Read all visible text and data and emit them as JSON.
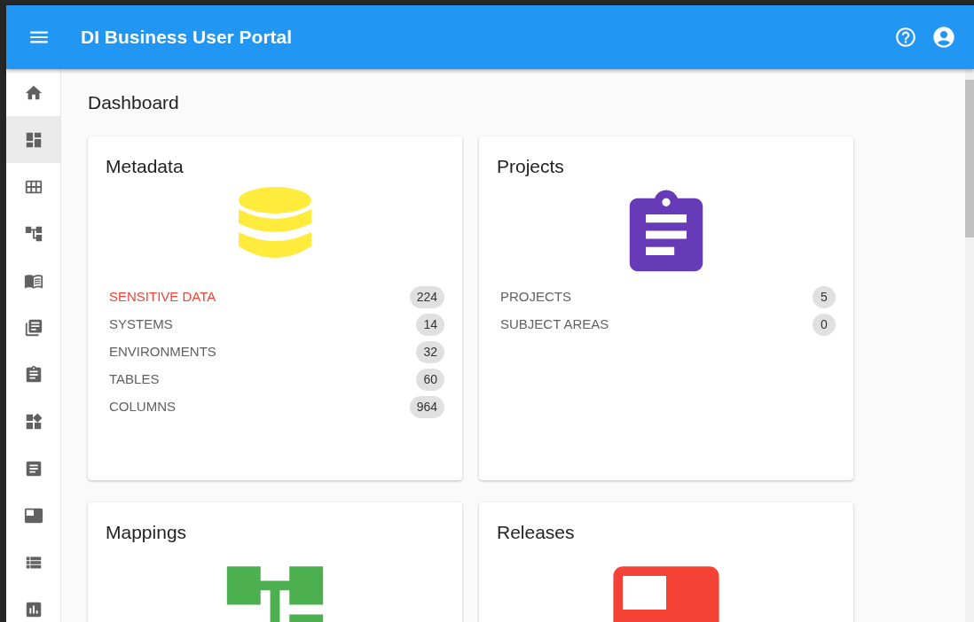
{
  "header": {
    "title": "DI Business User Portal"
  },
  "sidebar": {
    "items": [
      {
        "kind": "home",
        "selected": false
      },
      {
        "kind": "dashboard",
        "selected": true
      },
      {
        "kind": "table",
        "selected": false
      },
      {
        "kind": "tree",
        "selected": false
      },
      {
        "kind": "book",
        "selected": false
      },
      {
        "kind": "library",
        "selected": false
      },
      {
        "kind": "clipboard",
        "selected": false
      },
      {
        "kind": "widgets",
        "selected": false
      },
      {
        "kind": "article",
        "selected": false
      },
      {
        "kind": "release",
        "selected": false
      },
      {
        "kind": "list",
        "selected": false
      },
      {
        "kind": "chart",
        "selected": false
      }
    ]
  },
  "page_title": "Dashboard",
  "cards": [
    {
      "title": "Metadata",
      "kind": "database",
      "stats": [
        {
          "label": "SENSITIVE DATA",
          "count": "224",
          "alert": true
        },
        {
          "label": "SYSTEMS",
          "count": "14",
          "alert": false
        },
        {
          "label": "ENVIRONMENTS",
          "count": "32",
          "alert": false
        },
        {
          "label": "TABLES",
          "count": "60",
          "alert": false
        },
        {
          "label": "COLUMNS",
          "count": "964",
          "alert": false
        }
      ]
    },
    {
      "title": "Projects",
      "kind": "projects",
      "stats": [
        {
          "label": "PROJECTS",
          "count": "5",
          "alert": false
        },
        {
          "label": "SUBJECT AREAS",
          "count": "0",
          "alert": false
        }
      ]
    },
    {
      "title": "Mappings",
      "kind": "mappings"
    },
    {
      "title": "Releases",
      "kind": "releases"
    }
  ]
}
